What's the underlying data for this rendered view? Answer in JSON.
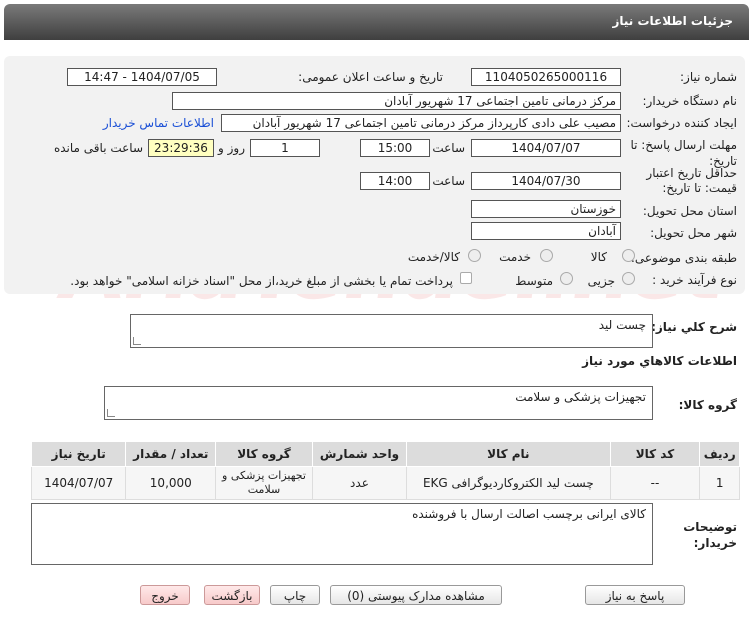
{
  "header": {
    "title": "جزئیات اطلاعات نیاز"
  },
  "watermark": "AriaTender.net",
  "fields": {
    "need_number_label": "شماره نیاز:",
    "need_number": "1104050265000116",
    "announce_label": "تاریخ و ساعت اعلان عمومی:",
    "announce_value": "1404/07/05 - 14:47",
    "buyer_org_label": "نام دستگاه خریدار:",
    "buyer_org": "مرکز درمانی تامین اجتماعی 17 شهریور آبادان",
    "requester_label": "ایجاد کننده درخواست:",
    "requester": "مصیب علی دادی کارپرداز مرکز درمانی تامین اجتماعی 17 شهریور آبادان",
    "contact_link": "اطلاعات تماس خریدار",
    "deadline_label": "مهلت ارسال پاسخ: تا تاریخ:",
    "deadline_date": "1404/07/07",
    "time_label": "ساعت",
    "deadline_time": "15:00",
    "days_value": "1",
    "days_label": "روز و",
    "remaining_value": "23:29:36",
    "remaining_label": "ساعت باقی مانده",
    "validity_label_1": "حداقل تاریخ اعتبار",
    "validity_label_2": "قیمت: تا تاریخ:",
    "validity_date": "1404/07/30",
    "validity_time": "14:00",
    "province_label": "استان محل تحویل:",
    "province": "خوزستان",
    "city_label": "شهر محل تحویل:",
    "city": "آبادان",
    "category_label": "طبقه بندی موضوعی:",
    "category_options": [
      "کالا",
      "خدمت",
      "کالا/خدمت"
    ],
    "process_label": "نوع فرآیند خرید :",
    "process_options": [
      "جزیی",
      "متوسط"
    ],
    "payment_note": "پرداخت تمام یا بخشی از مبلغ خرید،از محل \"اسناد خزانه اسلامی\" خواهد بود."
  },
  "summary": {
    "label": "شرح کلي نياز:",
    "value": "چست لید"
  },
  "goods_info_title": "اطلاعات کالاهاي مورد نياز",
  "goods_group": {
    "label": "گروه کالا:",
    "value": "تجهیزات پزشکی و سلامت"
  },
  "table": {
    "headers": [
      "رديف",
      "کد کالا",
      "نام کالا",
      "واحد شمارش",
      "گروه کالا",
      "تعداد / مقدار",
      "تاريخ نياز"
    ],
    "rows": [
      [
        "1",
        "--",
        "چست لید الکتروکاردیوگرافی EKG",
        "عدد",
        "تجهیزات پزشکی و سلامت",
        "10,000",
        "1404/07/07"
      ]
    ]
  },
  "buyer_notes": {
    "label_1": "توضیحات",
    "label_2": "خریدار:",
    "value": "کالای ایرانی برچسب اصالت ارسال با فروشنده"
  },
  "buttons": {
    "reply": "پاسخ به نیاز",
    "attachments": "مشاهده مدارک پیوستی (0)",
    "print": "چاپ",
    "back": "بازگشت",
    "exit": "خروج"
  }
}
